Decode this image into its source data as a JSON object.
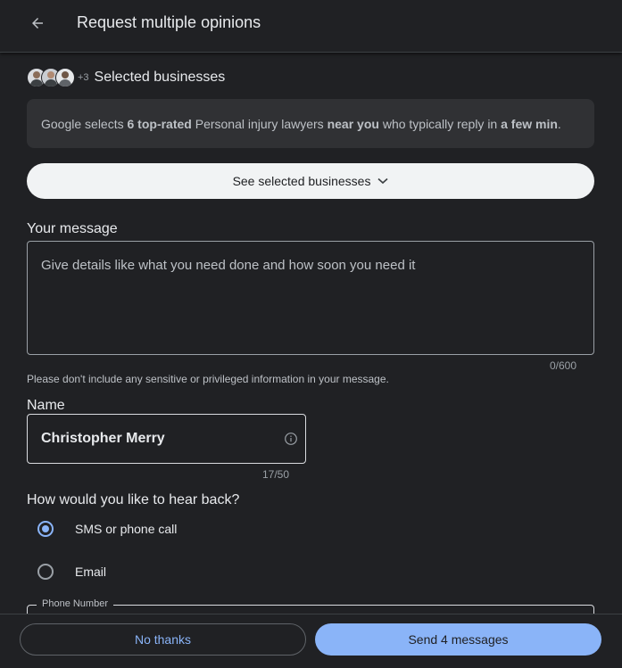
{
  "header": {
    "title": "Request multiple opinions",
    "back_icon": "arrow-back-icon"
  },
  "businesses": {
    "extra_count": "+3",
    "label": "Selected businesses",
    "avatars": [
      "avatar-1",
      "avatar-2",
      "avatar-3"
    ]
  },
  "info": {
    "part1": "Google selects ",
    "bold1": "6 top-rated",
    "part2": " Personal injury lawyers ",
    "bold2": "near you",
    "part3": " who typically reply in ",
    "bold3": "a few min",
    "part4": "."
  },
  "see_button": {
    "label": "See selected businesses",
    "icon": "chevron-down-icon"
  },
  "message": {
    "label": "Your message",
    "placeholder": "Give details like what you need done and how soon you need it",
    "counter": "0/600",
    "hint": "Please don't include any sensitive or privileged information in your message."
  },
  "name": {
    "label": "Name",
    "value": "Christopher Merry",
    "counter": "17/50",
    "icon": "info-icon"
  },
  "contact": {
    "question": "How would you like to hear back?",
    "options": [
      {
        "label": "SMS or phone call",
        "selected": true
      },
      {
        "label": "Email",
        "selected": false
      }
    ]
  },
  "phone": {
    "label": "Phone Number"
  },
  "footer": {
    "no_thanks": "No thanks",
    "send": "Send 4 messages"
  },
  "colors": {
    "background": "#202124",
    "surface": "#303134",
    "accent": "#8ab4f8",
    "text": "#e8eaed"
  }
}
